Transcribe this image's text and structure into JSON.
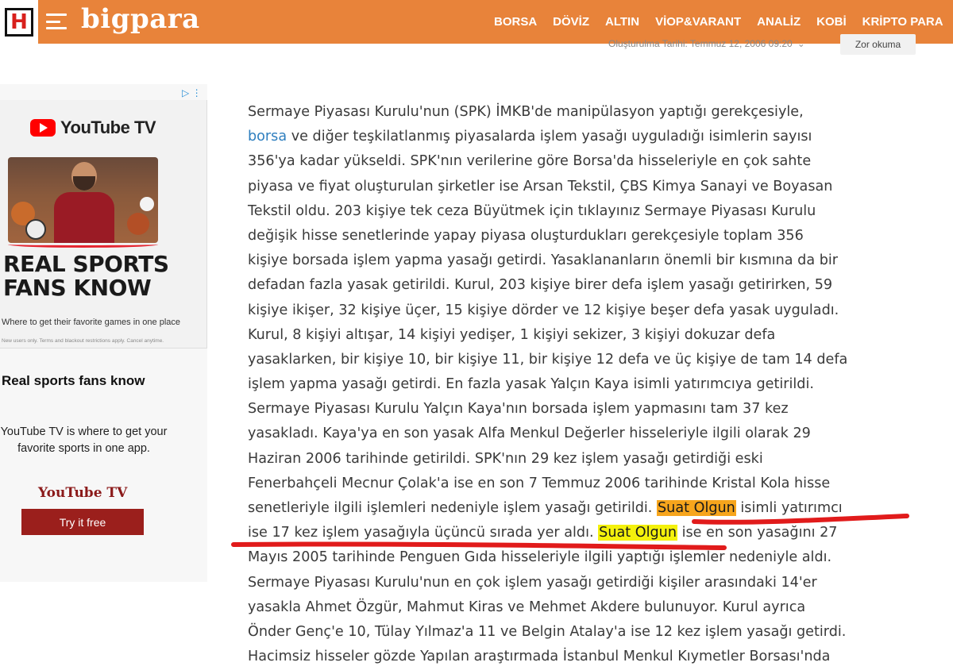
{
  "header": {
    "logo_letter": "H",
    "brand": "bigpara",
    "nav": [
      "BORSA",
      "DÖVİZ",
      "ALTIN",
      "VİOP&VARANT",
      "ANALİZ",
      "KOBİ",
      "KRİPTO PARA"
    ],
    "meta": "Oluşturulma Tarihi: Temmuz 12, 2006 09:20",
    "read_button": "Zor okuma"
  },
  "ad": {
    "choice_icon": "ad-choices-icon",
    "brand_logo": "YouTube TV",
    "headline_1": "REAL SPORTS",
    "headline_2": "FANS KNOW",
    "sub": "Where to get their favorite games in one place",
    "fine": "New users only. Terms and blackout restrictions apply. Cancel anytime.",
    "title": "Real sports fans know",
    "description": "YouTube TV is where to get your favorite sports in one app.",
    "brand_name": "YouTube TV",
    "cta": "Try it free",
    "colors": {
      "brand_red": "#9b1f1c",
      "yt_red": "#ff0000"
    }
  },
  "article": {
    "link_word": "borsa",
    "highlight_name": "Suat Olgun",
    "lines": [
      "Sermaye Piyasası Kurulu'nun (SPK) İMKB'de manipülasyon yaptığı gerekçesiyle,",
      "ve diğer teşkilatlanmış piyasalarda işlem yasağı uyguladığı isimlerin sayısı",
      "356'ya kadar yükseldi. SPK'nın verilerine göre Borsa'da hisseleriyle en çok sahte",
      "piyasa ve fiyat oluşturulan şirketler ise Arsan Tekstil, ÇBS Kimya Sanayi ve Boyasan",
      "Tekstil oldu. 203 kişiye tek ceza Büyütmek için tıklayınız Sermaye Piyasası Kurulu",
      "değişik hisse senetlerinde yapay piyasa oluşturdukları gerekçesiyle toplam 356",
      "kişiye borsada işlem yapma yasağı getirdi. Yasaklananların önemli bir kısmına da bir",
      "defadan fazla yasak getirildi. Kurul, 203 kişiye birer defa işlem yasağı getirirken, 59",
      "kişiye ikişer, 32 kişiye üçer, 15 kişiye dörder ve 12 kişiye beşer defa yasak uyguladı.",
      "Kurul, 8 kişiyi altışar, 14 kişiyi yedişer, 1 kişiyi sekizer, 3 kişiyi dokuzar defa",
      "yasaklarken, bir kişiye 10, bir kişiye 11, bir kişiye 12 defa ve üç kişiye de tam 14 defa",
      "işlem yapma yasağı getirdi. En fazla yasak Yalçın Kaya isimli yatırımcıya getirildi.",
      "Sermaye Piyasası Kurulu Yalçın Kaya'nın borsada işlem yapmasını tam 37 kez",
      "yasakladı. Kaya'ya en son yasak Alfa Menkul Değerler hisseleriyle ilgili olarak 29",
      "Haziran 2006 tarihinde getirildi. SPK'nın 29 kez işlem yasağı getirdiği eski",
      "Fenerbahçeli Mecnur Çolak'a ise en son 7 Temmuz 2006 tarihinde Kristal Kola hisse",
      "senetleriyle ilgili işlemleri nedeniyle işlem yasağı getirildi.",
      "isimli yatırımcı",
      "ise 17 kez işlem yasağıyla üçüncü sırada yer aldı.",
      "ise en son yasağını 27",
      "Mayıs 2005 tarihinde Penguen Gıda hisseleriyle ilgili yaptığı işlemler nedeniyle aldı.",
      "Sermaye Piyasası Kurulu'nun en çok işlem yasağı getirdiği kişiler arasındaki 14'er",
      "yasakla Ahmet Özgür, Mahmut Kiras ve Mehmet Akdere bulunuyor. Kurul ayrıca",
      "Önder Genç'e 10, Tülay Yılmaz'a 11 ve Belgin Atalay'a ise 12 kez işlem yasağı getirdi.",
      "Hacimsiz hisseler gözde Yapılan araştırmada İstanbul Menkul Kıymetler Borsası'nda"
    ]
  }
}
